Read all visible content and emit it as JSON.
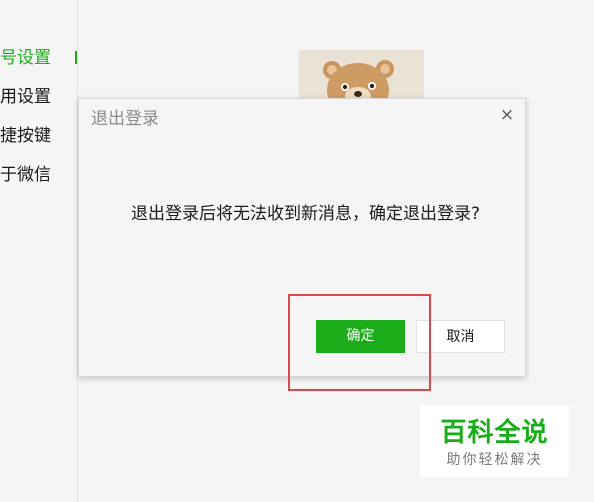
{
  "sidebar": {
    "items": [
      {
        "label": "号设置",
        "active": true
      },
      {
        "label": "用设置",
        "active": false
      },
      {
        "label": "捷按键",
        "active": false
      },
      {
        "label": "于微信",
        "active": false
      }
    ],
    "active_color": "#1aad19"
  },
  "dialog": {
    "title": "退出登录",
    "close_glyph": "×",
    "message": "退出登录后将无法收到新消息，确定退出登录?",
    "confirm_label": "确定",
    "cancel_label": "取消"
  },
  "watermark": {
    "title": "百科全说",
    "subtitle": "助你轻松解决"
  },
  "colors": {
    "accent": "#1aad19",
    "annotation": "#d94a4a",
    "background": "#f5f5f5"
  }
}
